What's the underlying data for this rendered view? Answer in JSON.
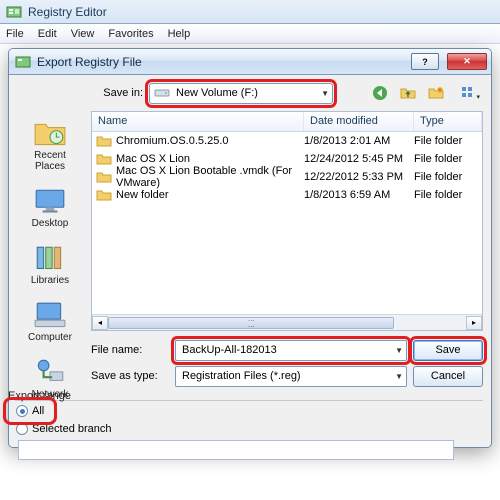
{
  "app": {
    "title": "Registry Editor",
    "menu": [
      "File",
      "Edit",
      "View",
      "Favorites",
      "Help"
    ]
  },
  "dialog": {
    "title": "Export Registry File",
    "savein_label": "Save in:",
    "savein_value": "New Volume (F:)",
    "columns": {
      "name": "Name",
      "date": "Date modified",
      "type": "Type"
    },
    "rows": [
      {
        "name": "Chromium.OS.0.5.25.0",
        "date": "1/8/2013 2:01 AM",
        "type": "File folder"
      },
      {
        "name": "Mac OS X Lion",
        "date": "12/24/2012 5:45 PM",
        "type": "File folder"
      },
      {
        "name": "Mac OS X Lion Bootable .vmdk (For VMware)",
        "date": "12/22/2012 5:33 PM",
        "type": "File folder"
      },
      {
        "name": "New folder",
        "date": "1/8/2013 6:59 AM",
        "type": "File folder"
      }
    ],
    "filename_label": "File name:",
    "filename_value": "BackUp-All-182013",
    "saveastype_label": "Save as type:",
    "saveastype_value": "Registration Files (*.reg)",
    "save_btn": "Save",
    "cancel_btn": "Cancel",
    "places": [
      "Recent Places",
      "Desktop",
      "Libraries",
      "Computer",
      "Network"
    ]
  },
  "export": {
    "group": "Export range",
    "all": "All",
    "selected": "Selected branch",
    "branch_value": ""
  },
  "icons": {
    "back": "back-icon",
    "up": "up-icon",
    "newfolder": "newfolder-icon",
    "views": "views-icon"
  }
}
